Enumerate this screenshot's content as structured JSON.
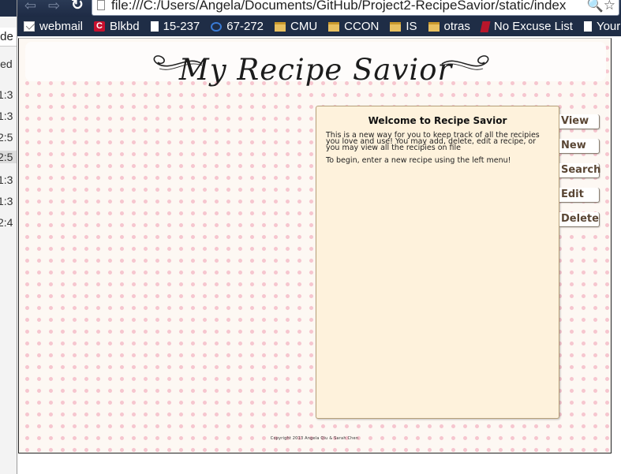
{
  "background_window": {
    "tab_fragment": "Ide",
    "list_fragments": [
      "ied",
      "1:3",
      "1:3",
      "2:5",
      "2:5",
      "1:3",
      "1:3",
      "2:4"
    ]
  },
  "browser": {
    "address": "file:///C:/Users/Angela/Documents/GitHub/Project2-RecipeSavior/static/index",
    "nav": {
      "back": "⇦",
      "forward": "⇨",
      "reload": "↻"
    },
    "address_icons": {
      "search": "🔍",
      "star": "☆"
    },
    "bookmarks": [
      {
        "label": "webmail",
        "icon": "mail-icon"
      },
      {
        "label": "Blkbd",
        "icon": "c-logo-icon"
      },
      {
        "label": "15-237",
        "icon": "document-icon"
      },
      {
        "label": "67-272",
        "icon": "ring-icon"
      },
      {
        "label": "CMU",
        "icon": "folder-icon"
      },
      {
        "label": "CCON",
        "icon": "folder-icon"
      },
      {
        "label": "IS",
        "icon": "folder-icon"
      },
      {
        "label": "otras",
        "icon": "folder-icon"
      },
      {
        "label": "No Excuse List",
        "icon": "no-excuse-icon"
      },
      {
        "label": "Your T",
        "icon": "document-icon"
      }
    ]
  },
  "app": {
    "title": "My Recipe Savior",
    "welcome": {
      "heading": "Welcome to Recipe Savior",
      "paragraph1": "This is a new way for you to keep track of all the recipies you love and use! You may add, delete, edit a recipe, or you may view all the recipies on file",
      "paragraph2": "To begin, enter a new recipe using the left menu!"
    },
    "menu": [
      "View",
      "New",
      "Search",
      "Edit",
      "Delete"
    ],
    "copyright": "Copyright 2013 Angela Qiu & Sarah Chen"
  },
  "colors": {
    "page_background": "#fdf8f3",
    "polka_dot": "#f6c6cf",
    "panel_background": "#fef2dc",
    "menu_text": "#5a4634",
    "chrome": "#1f2d46"
  }
}
